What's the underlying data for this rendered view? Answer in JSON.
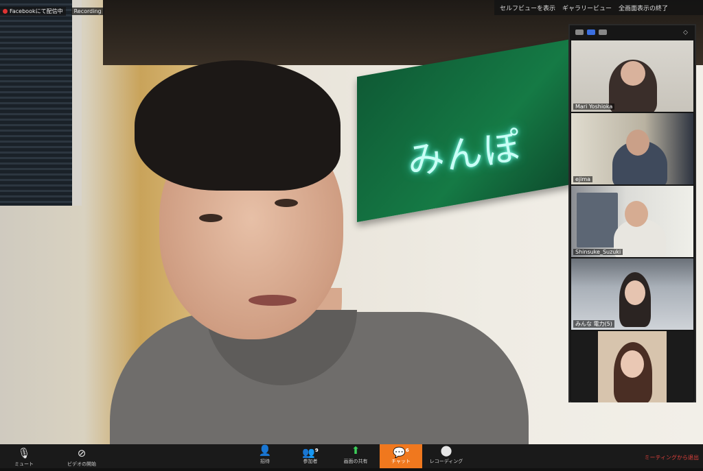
{
  "topleft": {
    "recording": "Facebookにて配信中",
    "extra": "Recording"
  },
  "topbar": {
    "items": [
      "セルフビューを表示",
      "ギャラリービュー",
      "全画面表示の終了"
    ]
  },
  "sign": {
    "text": "みんぽ"
  },
  "gallery": {
    "participants": [
      {
        "name": "Mari Yoshioka"
      },
      {
        "name": "ejima"
      },
      {
        "name": "Shinsuke_Suzuki"
      },
      {
        "name": "みんな 電力(5)"
      },
      {
        "name": ""
      }
    ]
  },
  "toolbar": {
    "left": [
      {
        "icon": "mic-icon",
        "label": "ミュート"
      },
      {
        "icon": "video-off-icon",
        "label": "ビデオの開始"
      }
    ],
    "center": [
      {
        "icon": "security-icon",
        "label": "招待"
      },
      {
        "icon": "participants-icon",
        "label": "参加者",
        "badge": "9"
      },
      {
        "icon": "share-screen-icon",
        "label": "画面の共有"
      },
      {
        "icon": "chat-icon",
        "label": "チャット",
        "badge": "6",
        "active": true
      },
      {
        "icon": "record-icon",
        "label": "レコーディング"
      }
    ],
    "end_label": "ミーティングから退出",
    "colors": {
      "active": "#f0781e",
      "share": "#3ccf5a",
      "end": "#e0413c"
    }
  }
}
